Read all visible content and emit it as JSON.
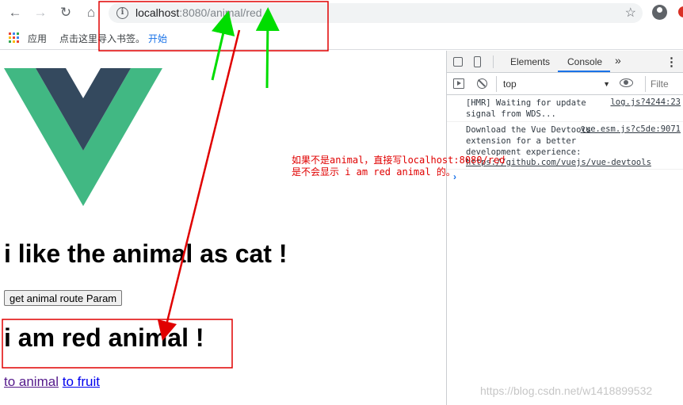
{
  "browser": {
    "back_icon": "arrow-left",
    "forward_icon": "arrow-right",
    "reload_icon": "reload",
    "home_icon": "home",
    "url_host": "localhost",
    "url_rest": ":8080/animal/red",
    "star_icon": "star",
    "account_icon": "account-circle"
  },
  "bookmarks": {
    "apps_label": "应用",
    "import_label": "点击这里导入书签。",
    "start_link": "开始"
  },
  "page": {
    "heading": "i like the animal as cat !",
    "button_label": "get animal route Param",
    "result": "i am red animal !",
    "link_animal": "to animal",
    "link_fruit": "to fruit"
  },
  "devtools": {
    "tab_elements": "Elements",
    "tab_console": "Console",
    "more_tabs": "»",
    "menu": "⋮",
    "context": "top",
    "filter_placeholder": "Filte",
    "messages": [
      {
        "text": "[HMR] Waiting for update signal from WDS...",
        "source": "log.js?4244:23"
      },
      {
        "text": "Download the Vue Devtools extension for a better development experience:",
        "link": "https://github.com/vuejs/vue-devtools",
        "source": "vue.esm.js?c5de:9071"
      }
    ]
  },
  "annotation": {
    "line1": "如果不是animal，直接写localhost:8080/red",
    "line2": "是不会显示 i am red animal 的。"
  },
  "watermark": "https://blog.csdn.net/w1418899532",
  "colors": {
    "vue_green": "#41b883",
    "vue_dark": "#34495e",
    "annotation_red": "#e00000",
    "arrow_green": "#00dd00",
    "accent_blue": "#1a73e8"
  }
}
